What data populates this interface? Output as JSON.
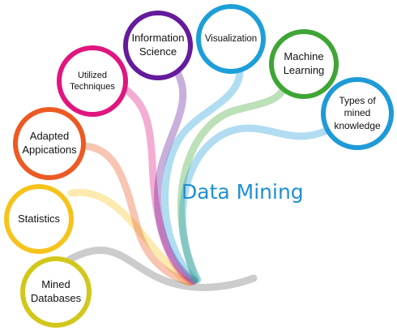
{
  "diagram": {
    "title": "Data Mining",
    "title_color": "#1e8fd6",
    "nodes": [
      {
        "id": "mined-databases",
        "lines": [
          "Mined",
          "Databases"
        ],
        "color": "#d2c71a"
      },
      {
        "id": "statistics",
        "lines": [
          "Statistics"
        ],
        "color": "#f6c31c"
      },
      {
        "id": "adapted-applications",
        "lines": [
          "Adapted",
          "Appications"
        ],
        "color": "#ec5a24"
      },
      {
        "id": "utilized-techniques",
        "lines": [
          "Utilized",
          "Techniques"
        ],
        "color": "#e0157e"
      },
      {
        "id": "information-science",
        "lines": [
          "Information",
          "Science"
        ],
        "color": "#641b9c"
      },
      {
        "id": "visualization",
        "lines": [
          "Visualization"
        ],
        "color": "#1c9fd8"
      },
      {
        "id": "machine-learning",
        "lines": [
          "Machine",
          "Learning"
        ],
        "color": "#3fa535"
      },
      {
        "id": "types-of-mined-knowledge",
        "lines": [
          "Types of",
          "mined",
          "knowledge"
        ],
        "color": "#1f9ad8"
      }
    ]
  }
}
